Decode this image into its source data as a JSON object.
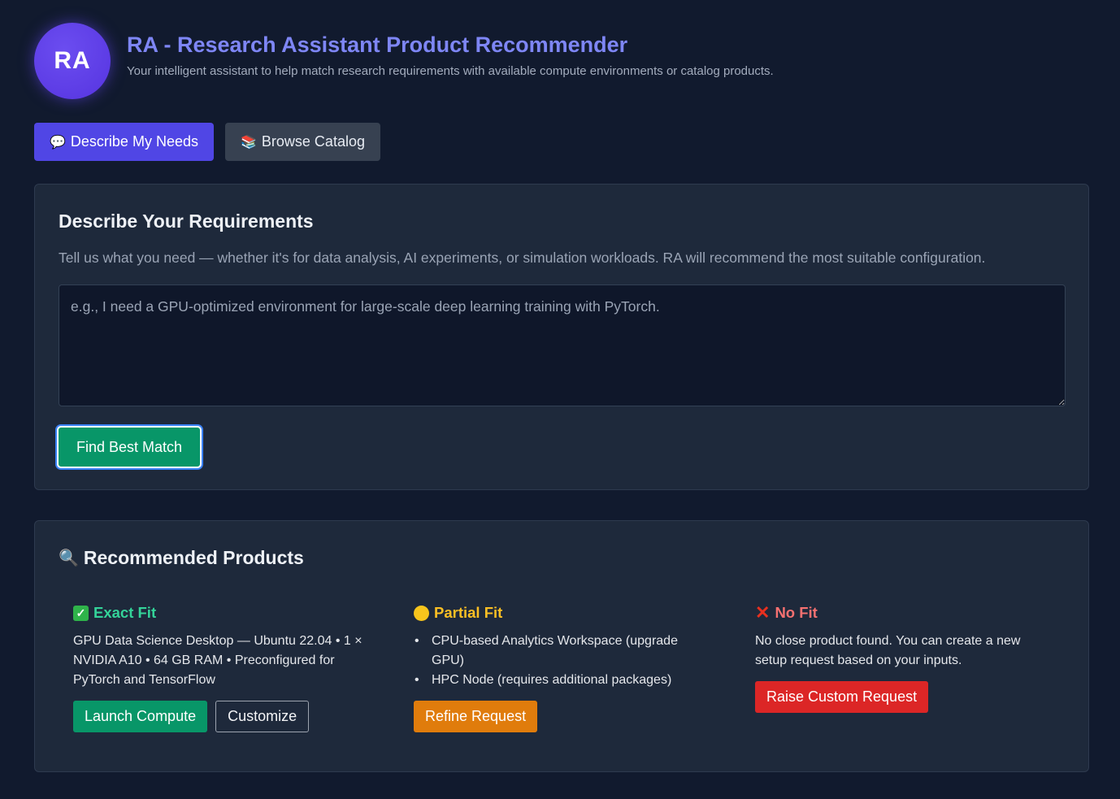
{
  "header": {
    "avatar_text": "RA",
    "title": "RA - Research Assistant Product Recommender",
    "subtitle": "Your intelligent assistant to help match research requirements with available compute environments or catalog products."
  },
  "tabs": [
    {
      "label": "Describe My Needs",
      "icon": "speech-bubble-icon",
      "active": true
    },
    {
      "label": "Browse Catalog",
      "icon": "books-icon",
      "active": false
    }
  ],
  "requirements": {
    "heading": "Describe Your Requirements",
    "description": "Tell us what you need — whether it's for data analysis, AI experiments, or simulation workloads. RA will recommend the most suitable configuration.",
    "input_value": "",
    "input_placeholder": "e.g., I need a GPU-optimized environment for large-scale deep learning training with PyTorch.",
    "submit_label": "Find Best Match"
  },
  "recommendations": {
    "heading": "Recommended Products",
    "exact": {
      "title": "Exact Fit",
      "text": "GPU Data Science Desktop — Ubuntu 22.04 • 1 × NVIDIA A10 • 64 GB RAM • Preconfigured for PyTorch and TensorFlow",
      "primary_label": "Launch Compute",
      "secondary_label": "Customize"
    },
    "partial": {
      "title": "Partial Fit",
      "items": [
        "CPU-based Analytics Workspace (upgrade GPU)",
        "HPC Node (requires additional packages)"
      ],
      "button_label": "Refine Request"
    },
    "none": {
      "title": "No Fit",
      "text": "No close product found. You can create a new setup request based on your inputs.",
      "button_label": "Raise Custom Request"
    }
  },
  "colors": {
    "background": "#111a2e",
    "panel": "#1e293b",
    "accent": "#5046e5",
    "title": "#7e86f5",
    "success": "#089668",
    "warning": "#e07c0c",
    "danger": "#dc2626"
  }
}
